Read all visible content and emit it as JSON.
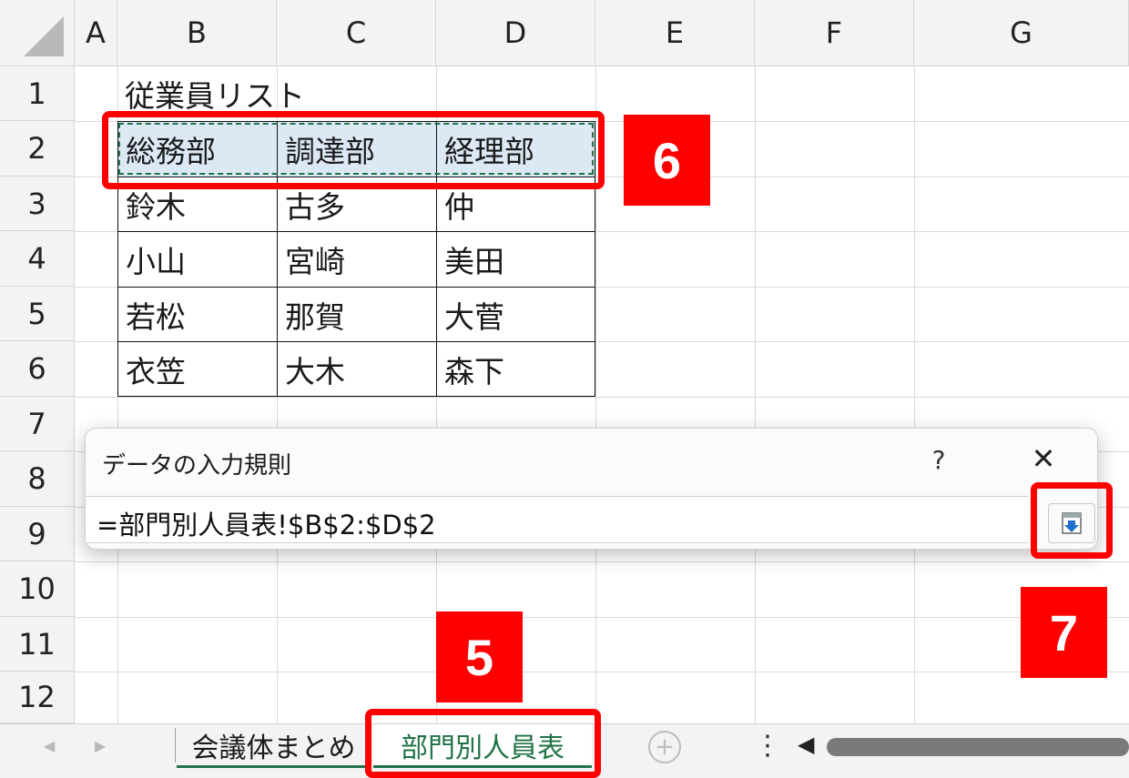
{
  "columns": [
    "A",
    "B",
    "C",
    "D",
    "E",
    "F",
    "G"
  ],
  "rows": [
    "1",
    "2",
    "3",
    "4",
    "5",
    "6",
    "7",
    "8",
    "9",
    "10",
    "11",
    "12"
  ],
  "cells": {
    "B1": "従業員リスト",
    "B2": "総務部",
    "C2": "調達部",
    "D2": "経理部",
    "B3": "鈴木",
    "C3": "古多",
    "D3": "仲",
    "B4": "小山",
    "C4": "宮崎",
    "D4": "美田",
    "B5": "若松",
    "C5": "那賀",
    "D5": "大菅",
    "B6": "衣笠",
    "C6": "大木",
    "D6": "森下"
  },
  "dialog": {
    "title": "データの入力規則",
    "help": "?",
    "close": "✕",
    "formula": "=部門別人員表!$B$2:$D$2",
    "expand_icon": "expand-dialog-icon"
  },
  "sheet_tabs": {
    "prev": "◀",
    "next": "▶",
    "tabs": [
      "会議体まとめ",
      "部門別人員表"
    ],
    "active_index": 1,
    "add": "+",
    "more": "⋮",
    "scroll_left": "◀"
  },
  "annotations": {
    "step5": "5",
    "step6": "6",
    "step7": "7"
  },
  "colors": {
    "accent": "#ff0000",
    "active_tab": "#217346",
    "selection_fill": "#dde8f5",
    "marquee": "#217346"
  }
}
